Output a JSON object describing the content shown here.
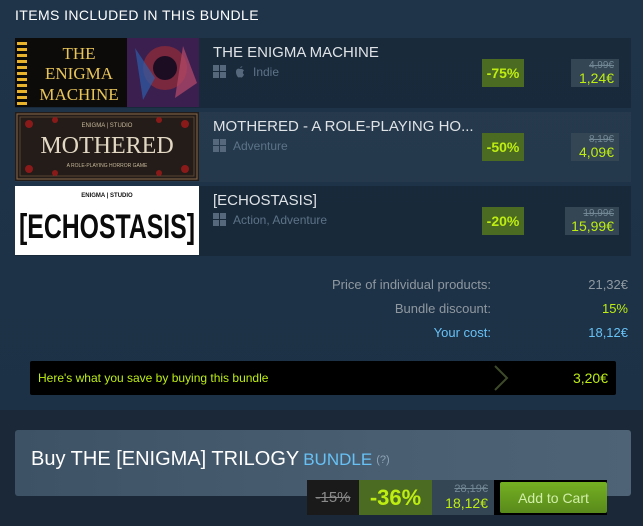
{
  "section_title": "ITEMS INCLUDED IN THIS BUNDLE",
  "items": [
    {
      "name": "THE ENIGMA MACHINE",
      "capsule_lines": [
        "THE",
        "ENIGMA",
        "MACHINE"
      ],
      "platforms": [
        "windows-icon",
        "apple-icon"
      ],
      "tags": "Indie",
      "discount": "-75%",
      "original_price": "4,99€",
      "final_price": "1,24€"
    },
    {
      "name": "MOTHERED - A ROLE-PLAYING HO...",
      "capsule_top": "ENIGMA | STUDIO",
      "capsule_title": "MOTHERED",
      "capsule_sub": "A ROLE-PLAYING HORROR GAME",
      "platforms": [
        "windows-icon"
      ],
      "tags": "Adventure",
      "discount": "-50%",
      "original_price": "8,19€",
      "final_price": "4,09€"
    },
    {
      "name": "[ECHOSTASIS]",
      "capsule_top": "ENIGMA | STUDIO",
      "capsule_title": "[ECHOSTASIS]",
      "platforms": [
        "windows-icon"
      ],
      "tags": "Action, Adventure",
      "discount": "-20%",
      "original_price": "19,99€",
      "final_price": "15,99€"
    }
  ],
  "summary": {
    "individual_label": "Price of individual products:",
    "individual_value": "21,32€",
    "discount_label": "Bundle discount:",
    "discount_value": "15%",
    "cost_label": "Your cost:",
    "cost_value": "18,12€"
  },
  "savings": {
    "text": "Here's what you save by buying this bundle",
    "amount": "3,20€"
  },
  "buy": {
    "title": "Buy THE [ENIGMA] TRILOGY",
    "bundle_label": "BUNDLE",
    "help": "(?)",
    "bundle_discount": "-15%",
    "discount": "-36%",
    "original_price": "28,19€",
    "final_price": "18,12€",
    "cart_label": "Add to Cart"
  },
  "colors": {
    "background": "#1b2838",
    "discount_green": "#beee11",
    "discount_bg": "#4c6b22",
    "link_blue": "#67c1f5",
    "cart_green": "#75b022"
  }
}
